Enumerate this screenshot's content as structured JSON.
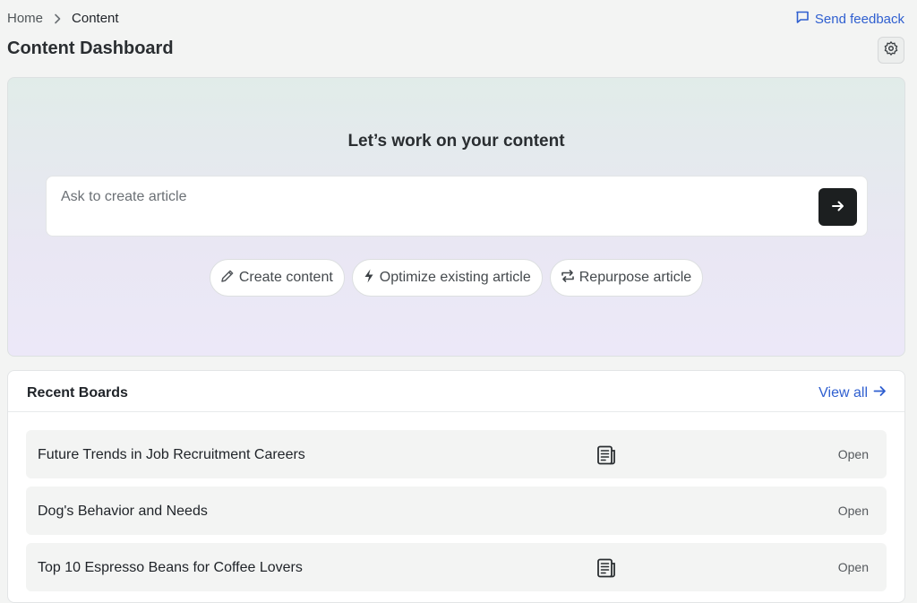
{
  "breadcrumb": {
    "home": "Home",
    "current": "Content"
  },
  "header": {
    "title": "Content Dashboard",
    "feedback_label": "Send feedback"
  },
  "hero": {
    "title": "Let’s work on your content",
    "prompt_placeholder": "Ask to create article",
    "chips": [
      {
        "label": "Create content",
        "icon": "pencil-icon"
      },
      {
        "label": "Optimize existing article",
        "icon": "bolt-icon"
      },
      {
        "label": "Repurpose article",
        "icon": "repeat-icon"
      }
    ]
  },
  "boards": {
    "title": "Recent Boards",
    "view_all": "View all",
    "items": [
      {
        "name": "Future Trends in Job Recruitment Careers",
        "has_doc_icon": true,
        "action": "Open"
      },
      {
        "name": "Dog's Behavior and Needs",
        "has_doc_icon": false,
        "action": "Open"
      },
      {
        "name": "Top 10 Espresso Beans for Coffee Lovers",
        "has_doc_icon": true,
        "action": "Open"
      }
    ]
  },
  "colors": {
    "accent": "#2f5fd0",
    "send_button": "#1c1f20"
  }
}
